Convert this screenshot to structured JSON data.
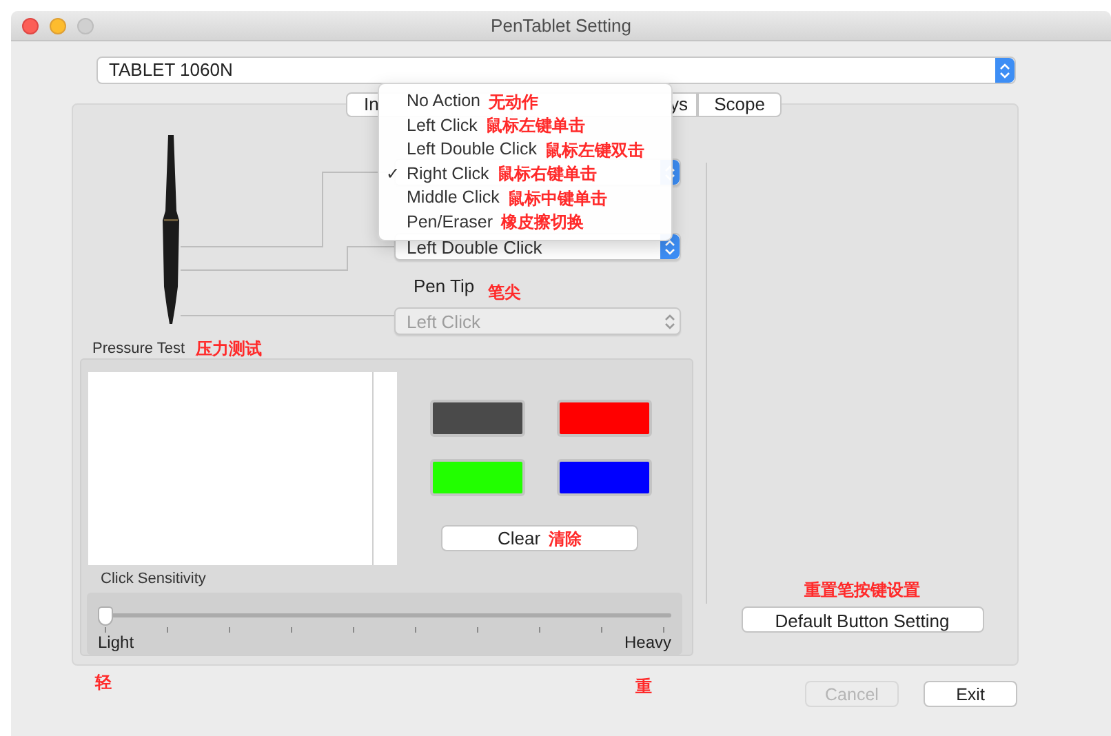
{
  "window": {
    "title": "PenTablet Setting"
  },
  "device_select": {
    "value": "TABLET 1060N"
  },
  "tabs": [
    {
      "label": "In"
    },
    {
      "label": "ys"
    },
    {
      "label": "Scope"
    }
  ],
  "button_menu": {
    "check_mark": "✓",
    "items": [
      {
        "label": "No Action",
        "annotation": "无动作",
        "selected": false
      },
      {
        "label": "Left Click",
        "annotation": "鼠标左键单击",
        "selected": false
      },
      {
        "label": "Left Double Click",
        "annotation": "鼠标左键双击",
        "selected": false
      },
      {
        "label": "Right Click",
        "annotation": "鼠标右键单击",
        "selected": true
      },
      {
        "label": "Middle Click",
        "annotation": "鼠标中键单击",
        "selected": false
      },
      {
        "label": "Pen/Eraser",
        "annotation": "橡皮擦切换",
        "selected": false
      }
    ]
  },
  "lower_button_select": {
    "value": "Left Double Click",
    "disabled": false
  },
  "pen_tip": {
    "label": "Pen Tip",
    "annotation": "笔尖",
    "select": {
      "value": "Left Click",
      "disabled": true
    }
  },
  "pressure_test": {
    "label": "Pressure Test",
    "annotation": "压力测试",
    "colors": [
      {
        "color": "#4a4a4a"
      },
      {
        "color": "#ff0000"
      },
      {
        "color": "#22ff00"
      },
      {
        "color": "#0000ff"
      }
    ],
    "clear_button": {
      "label": "Clear",
      "annotation": "清除"
    }
  },
  "click_sensitivity": {
    "label": "Click Sensitivity",
    "level": 0,
    "min_label": "Light",
    "min_annotation": "轻",
    "max_label": "Heavy",
    "max_annotation": "重"
  },
  "default_button": {
    "annotation": "重置笔按键设置",
    "label": "Default Button Setting"
  },
  "buttons": [
    {
      "label": "Cancel",
      "disabled": true
    },
    {
      "label": "Exit",
      "disabled": false
    }
  ]
}
